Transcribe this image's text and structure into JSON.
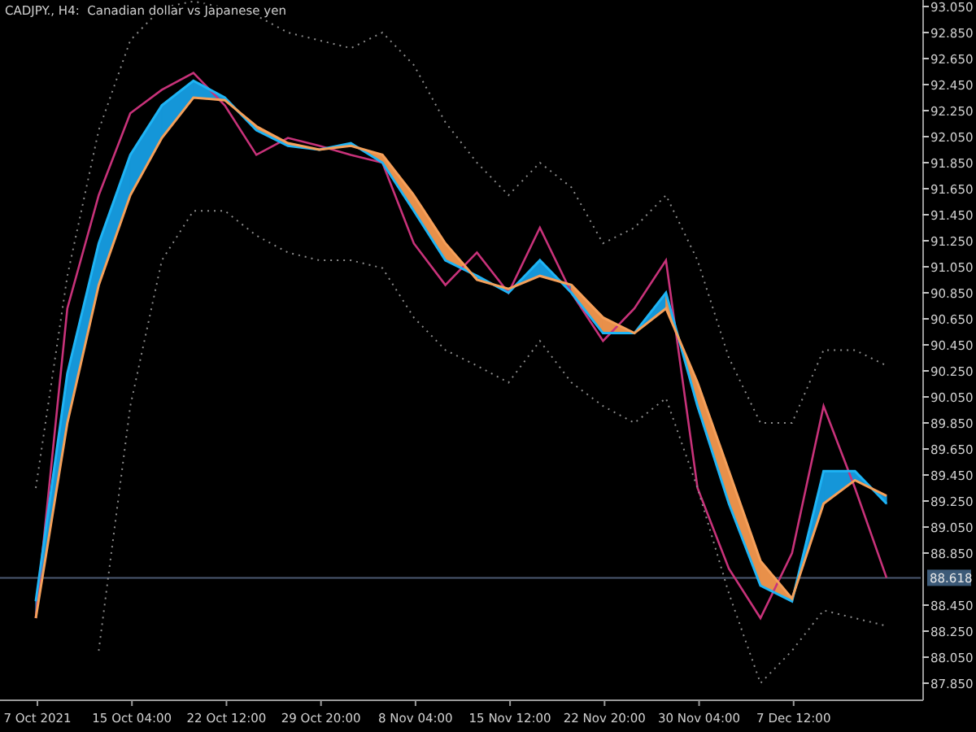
{
  "chart_data": {
    "type": "line",
    "title": "CADJPY., H4:  Canadian dollar vs Japanese yen",
    "categories": [
      "7 Oct 2021",
      null,
      null,
      "15 Oct 04:00",
      null,
      null,
      "22 Oct 12:00",
      null,
      null,
      "29 Oct 20:00",
      null,
      null,
      "8 Nov 04:00",
      null,
      null,
      "15 Nov 12:00",
      null,
      null,
      "22 Nov 20:00",
      null,
      null,
      "30 Nov 04:00",
      null,
      null,
      "7 Dec 12:00",
      null,
      null,
      null
    ],
    "ylim": [
      87.725,
      93.1
    ],
    "yticks": [
      {
        "value": 93.05,
        "label": "93.050"
      },
      {
        "value": 92.85,
        "label": "92.850"
      },
      {
        "value": 92.65,
        "label": "92.650"
      },
      {
        "value": 92.45,
        "label": "92.450"
      },
      {
        "value": 92.25,
        "label": "92.250"
      },
      {
        "value": 92.05,
        "label": "92.050"
      },
      {
        "value": 91.85,
        "label": "91.850"
      },
      {
        "value": 91.65,
        "label": "91.650"
      },
      {
        "value": 91.45,
        "label": "91.450"
      },
      {
        "value": 91.25,
        "label": "91.250"
      },
      {
        "value": 91.05,
        "label": "91.050"
      },
      {
        "value": 90.85,
        "label": "90.850"
      },
      {
        "value": 90.65,
        "label": "90.650"
      },
      {
        "value": 90.45,
        "label": "90.450"
      },
      {
        "value": 90.25,
        "label": "90.250"
      },
      {
        "value": 90.05,
        "label": "90.050"
      },
      {
        "value": 89.85,
        "label": "89.850"
      },
      {
        "value": 89.65,
        "label": "89.650"
      },
      {
        "value": 89.45,
        "label": "89.450"
      },
      {
        "value": 89.25,
        "label": "89.250"
      },
      {
        "value": 89.05,
        "label": "89.050"
      },
      {
        "value": 88.85,
        "label": "88.850"
      },
      {
        "value": 88.45,
        "label": "88.450"
      },
      {
        "value": 88.25,
        "label": "88.250"
      },
      {
        "value": 88.05,
        "label": "88.050"
      },
      {
        "value": 87.85,
        "label": "87.850"
      }
    ],
    "series": [
      {
        "color": "#c8327a",
        "values": [
          88.35,
          90.73,
          91.6,
          92.23,
          92.41,
          92.54,
          92.29,
          91.91,
          92.04,
          91.98,
          91.91,
          91.85,
          91.23,
          90.91,
          91.16,
          90.85,
          91.35,
          90.85,
          90.48,
          90.73,
          91.1,
          89.35,
          88.73,
          88.35,
          88.85,
          89.98,
          89.35,
          88.66
        ]
      },
      {
        "color": "#1eb4f5",
        "values": [
          88.48,
          90.23,
          91.23,
          91.91,
          92.29,
          92.48,
          92.35,
          92.1,
          91.98,
          91.95,
          92.0,
          91.85,
          91.48,
          91.1,
          90.98,
          90.85,
          91.1,
          90.85,
          90.54,
          90.54,
          90.85,
          89.98,
          89.23,
          88.6,
          88.48,
          89.48,
          89.48,
          89.23
        ]
      },
      {
        "color": "#f5a05a",
        "values": [
          88.35,
          89.85,
          90.91,
          91.6,
          92.04,
          92.35,
          92.33,
          92.13,
          92.0,
          91.95,
          91.98,
          91.91,
          91.6,
          91.23,
          90.95,
          90.88,
          90.98,
          90.91,
          90.66,
          90.54,
          90.73,
          90.16,
          89.48,
          88.79,
          88.5,
          89.23,
          89.41,
          89.29
        ]
      },
      {
        "color": "#8c8c8c",
        "line_style": "dotted",
        "values": [
          89.35,
          90.98,
          92.1,
          92.79,
          93.04,
          93.09,
          93.04,
          92.98,
          92.85,
          92.79,
          92.73,
          92.85,
          92.6,
          92.16,
          91.85,
          91.6,
          91.85,
          91.66,
          91.23,
          91.35,
          91.6,
          91.1,
          90.35,
          89.85,
          89.85,
          90.41,
          90.41,
          90.29
        ]
      },
      {
        "color": "#8c8c8c",
        "line_style": "dotted",
        "values": [
          null,
          null,
          88.1,
          89.98,
          91.1,
          91.48,
          91.48,
          91.29,
          91.16,
          91.1,
          91.1,
          91.04,
          90.66,
          90.41,
          90.29,
          90.16,
          90.48,
          90.16,
          89.98,
          89.85,
          90.04,
          89.35,
          88.54,
          87.85,
          88.1,
          88.41,
          88.35,
          88.29
        ]
      }
    ]
  },
  "current_price_tag": "88.618"
}
